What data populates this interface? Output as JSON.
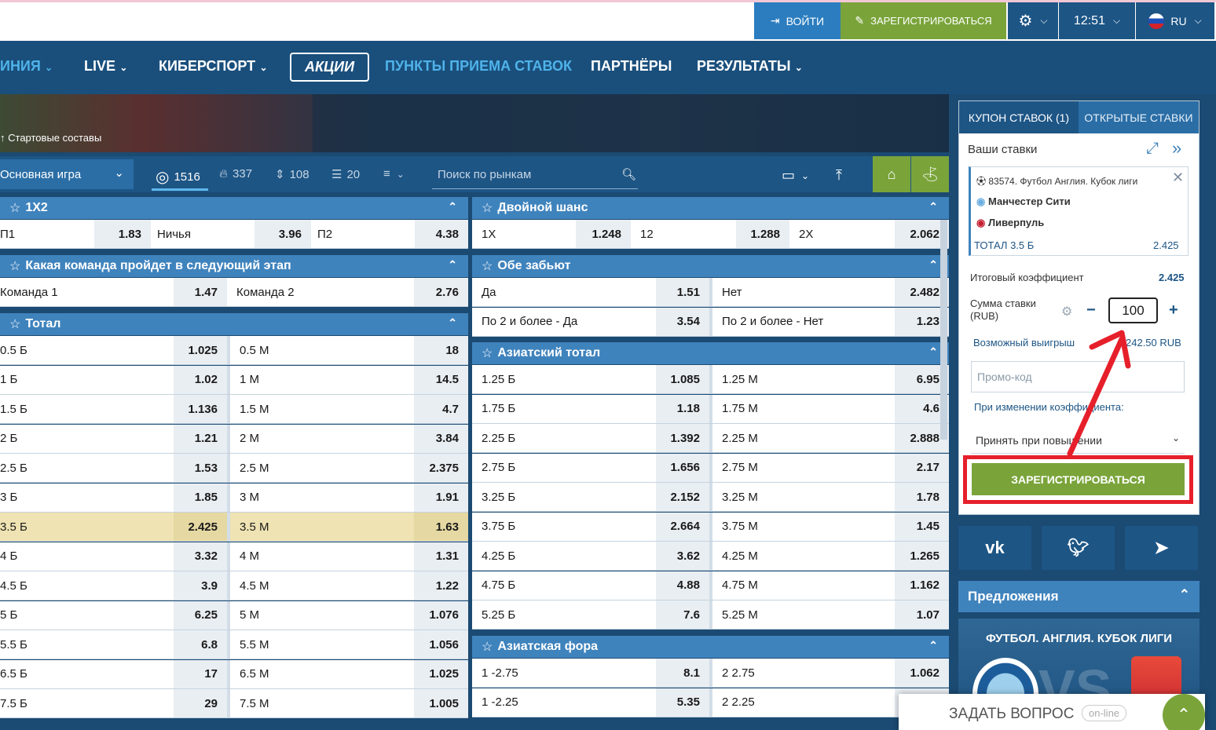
{
  "top_bar": {
    "login": "ВОЙТИ",
    "register": "ЗАРЕГИСТРИРОВАТЬСЯ",
    "time": "12:51",
    "lang": "RU"
  },
  "nav": {
    "line": "ИНИЯ",
    "live": "LIVE",
    "esports": "КИБЕРСПОРТ",
    "promo": "АКЦИИ",
    "points": "ПУНКТЫ ПРИЕМА СТАВОК",
    "partners": "ПАРТНЁРЫ",
    "results": "РЕЗУЛЬТАТЫ"
  },
  "hero": {
    "lineups": "Стартовые составы"
  },
  "filters": {
    "main_game": "Основная игра",
    "count_all": "1516",
    "count_hot": "337",
    "count_updown": "108",
    "count_chart": "20",
    "search_placeholder": "Поиск по рынкам"
  },
  "markets": {
    "m1x2": {
      "title": "1X2",
      "cells": [
        [
          "П1",
          "1.83"
        ],
        [
          "Ничья",
          "3.96"
        ],
        [
          "П2",
          "4.38"
        ]
      ]
    },
    "next_stage": {
      "title": "Какая команда пройдет в следующий этап",
      "cells": [
        [
          "Команда 1",
          "1.47"
        ],
        [
          "Команда 2",
          "2.76"
        ]
      ]
    },
    "total": {
      "title": "Тотал",
      "rows": [
        [
          "0.5 Б",
          "1.025",
          "0.5 М",
          "18"
        ],
        [
          "1 Б",
          "1.02",
          "1 М",
          "14.5"
        ],
        [
          "1.5 Б",
          "1.136",
          "1.5 М",
          "4.7"
        ],
        [
          "2 Б",
          "1.21",
          "2 М",
          "3.84"
        ],
        [
          "2.5 Б",
          "1.53",
          "2.5 М",
          "2.375"
        ],
        [
          "3 Б",
          "1.85",
          "3 М",
          "1.91"
        ],
        [
          "3.5 Б",
          "2.425",
          "3.5 М",
          "1.63"
        ],
        [
          "4 Б",
          "3.32",
          "4 М",
          "1.31"
        ],
        [
          "4.5 Б",
          "3.9",
          "4.5 М",
          "1.22"
        ],
        [
          "5 Б",
          "6.25",
          "5 М",
          "1.076"
        ],
        [
          "5.5 Б",
          "6.8",
          "5.5 М",
          "1.056"
        ],
        [
          "6.5 Б",
          "17",
          "6.5 М",
          "1.025"
        ],
        [
          "7.5 Б",
          "29",
          "7.5 М",
          "1.005"
        ]
      ]
    },
    "double_chance": {
      "title": "Двойной шанс",
      "cells": [
        [
          "1X",
          "1.248"
        ],
        [
          "12",
          "1.288"
        ],
        [
          "2X",
          "2.062"
        ]
      ]
    },
    "both_score": {
      "title": "Обе забьют",
      "rows": [
        [
          "Да",
          "1.51",
          "Нет",
          "2.482"
        ],
        [
          "По 2 и более - Да",
          "3.54",
          "По 2 и более - Нет",
          "1.23"
        ]
      ]
    },
    "asian_total": {
      "title": "Азиатский тотал",
      "rows": [
        [
          "1.25 Б",
          "1.085",
          "1.25 М",
          "6.95"
        ],
        [
          "1.75 Б",
          "1.18",
          "1.75 М",
          "4.6"
        ],
        [
          "2.25 Б",
          "1.392",
          "2.25 М",
          "2.888"
        ],
        [
          "2.75 Б",
          "1.656",
          "2.75 М",
          "2.17"
        ],
        [
          "3.25 Б",
          "2.152",
          "3.25 М",
          "1.78"
        ],
        [
          "3.75 Б",
          "2.664",
          "3.75 М",
          "1.45"
        ],
        [
          "4.25 Б",
          "3.62",
          "4.25 М",
          "1.265"
        ],
        [
          "4.75 Б",
          "4.88",
          "4.75 М",
          "1.162"
        ],
        [
          "5.25 Б",
          "7.6",
          "5.25 М",
          "1.07"
        ]
      ]
    },
    "asian_handicap": {
      "title": "Азиатская фора",
      "rows": [
        [
          "1 -2.75",
          "8.1",
          "2 2.75",
          "1.062"
        ],
        [
          "1 -2.25",
          "5.35",
          "2 2.25",
          ""
        ]
      ]
    }
  },
  "coupon": {
    "tab_coupon": "КУПОН СТАВОК (1)",
    "tab_open": "ОТКРЫТЫЕ СТАВКИ",
    "your_bets": "Ваши ставки",
    "event": "83574. Футбол Англия. Кубок лиги",
    "team1": "Манчестер Сити",
    "team2": "Ливерпуль",
    "bet": "ТОТАЛ 3.5 Б",
    "bet_odd": "2.425",
    "total_coef_label": "Итоговый коэффициент",
    "total_coef": "2.425",
    "stake_label": "Сумма ставки (RUB)",
    "stake": "100",
    "win_label": "Возможный выигрыш",
    "win": "242.50 RUB",
    "promo_placeholder": "Промо-код",
    "on_change": "При изменении коэффициента:",
    "accept": "Принять при повышении",
    "register": "ЗАРЕГИСТРИРОВАТЬСЯ"
  },
  "offers": {
    "title": "Предложения",
    "banner": "ФУТБОЛ. АНГЛИЯ. КУБОК ЛИГИ",
    "vs": "VS"
  },
  "chat": {
    "ask": "ЗАДАТЬ ВОПРОС",
    "status": "on-line"
  },
  "colors": {
    "brand_blue": "#1d5585",
    "header_blue": "#3f83bd",
    "green": "#7aa43a",
    "highlight": "#efe3b3",
    "annotation_red": "#e6202b"
  }
}
